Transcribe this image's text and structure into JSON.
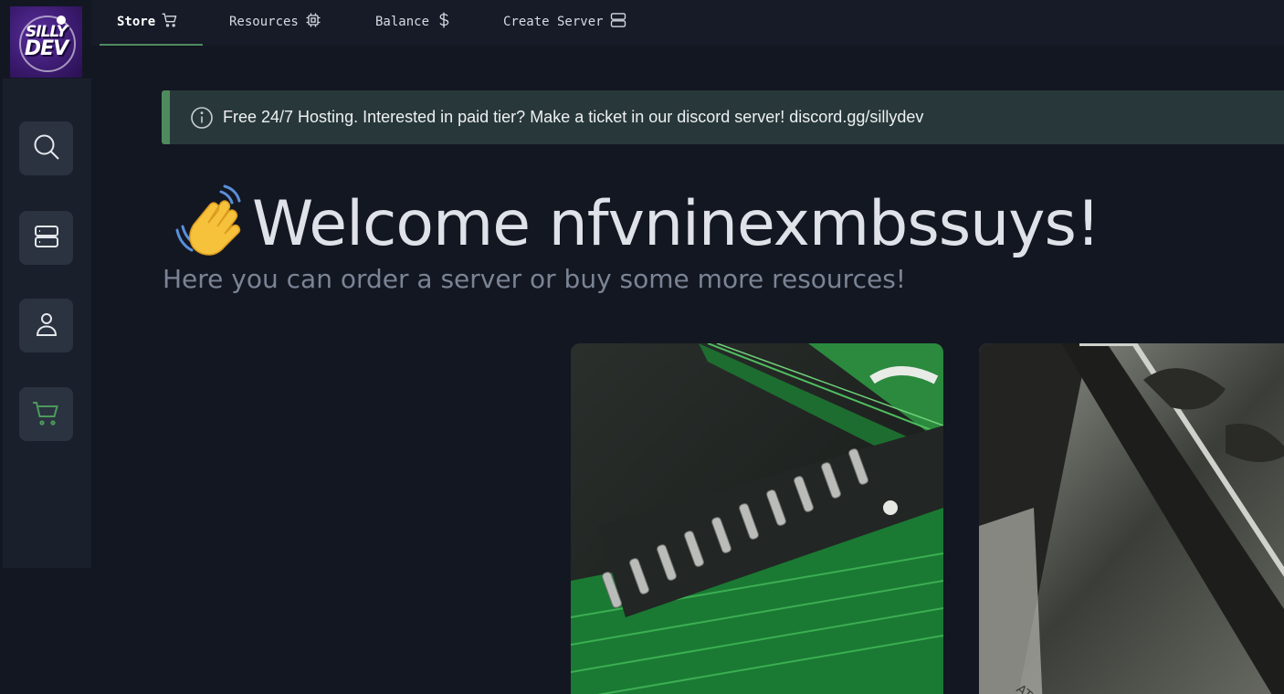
{
  "logo": {
    "line1": "SILLY",
    "line2": "DEV"
  },
  "nav": {
    "items": [
      {
        "label": "Store",
        "icon": "cart-icon",
        "active": true
      },
      {
        "label": "Resources",
        "icon": "cpu-icon",
        "active": false
      },
      {
        "label": "Balance",
        "icon": "dollar-icon",
        "active": false
      },
      {
        "label": "Create Server",
        "icon": "server-icon",
        "active": false
      }
    ],
    "accent": "#4f8a5e"
  },
  "sidebar": {
    "items": [
      {
        "name": "search",
        "icon": "search-icon"
      },
      {
        "name": "servers",
        "icon": "server-icon"
      },
      {
        "name": "account",
        "icon": "user-icon"
      },
      {
        "name": "store",
        "icon": "cart-icon",
        "active": true,
        "color": "#4c9a5c"
      }
    ]
  },
  "banner": {
    "text": "Free 24/7 Hosting. Interested in paid tier? Make a ticket in our discord server! discord.gg/sillydev",
    "icon": "info-icon"
  },
  "welcome": {
    "title": "Welcome nfvninexmbssuys!",
    "subtitle": "Here you can order a server or buy some more resources!",
    "emoji": "waving-hand-icon"
  },
  "cards": [
    {
      "name": "resources-card",
      "image": "circuit-board-image"
    },
    {
      "name": "balance-card",
      "image": "banknote-image"
    }
  ],
  "colors": {
    "background": "#131722",
    "sidebar": "#1a1f2c",
    "banner": "#28383a"
  }
}
